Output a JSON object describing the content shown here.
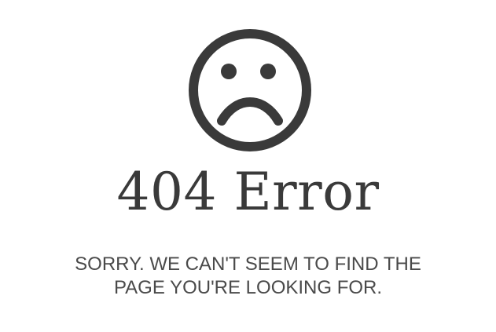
{
  "error": {
    "icon": "sad-face-icon",
    "title": "404 Error",
    "message_line_1": "SORRY. WE CAN'T SEEM TO FIND THE",
    "message_line_2": "PAGE YOU'RE LOOKING FOR."
  },
  "colors": {
    "background": "#ffffff",
    "icon": "#3a3a3a",
    "title": "#3a3a3a",
    "message": "#4a4a4a"
  }
}
